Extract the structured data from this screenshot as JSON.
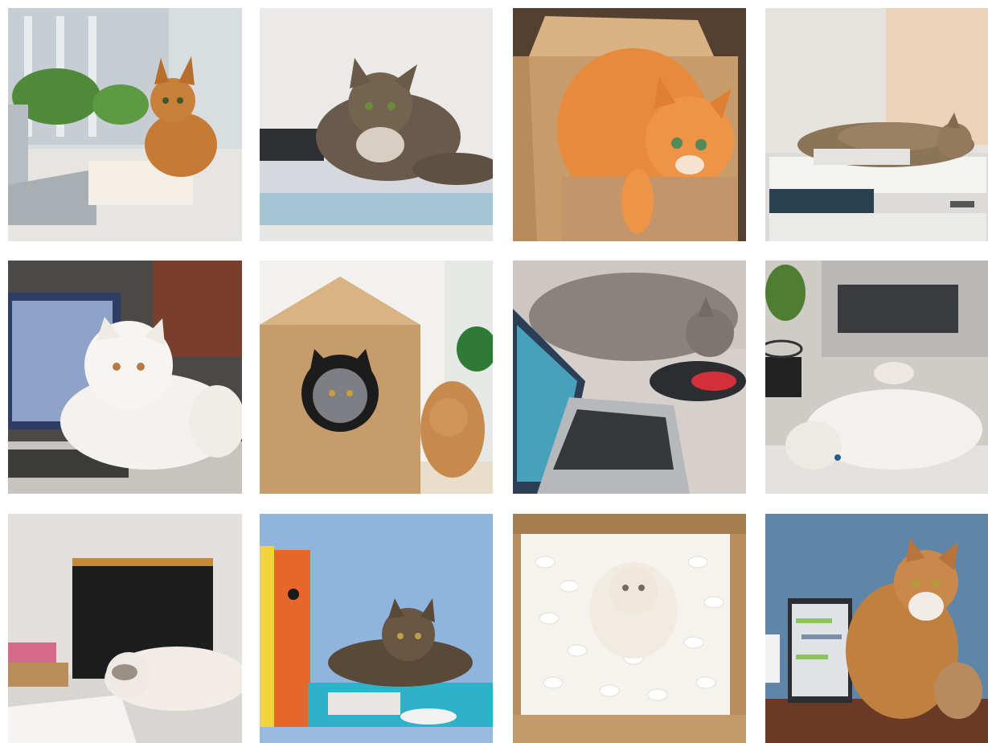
{
  "gallery": {
    "tiles": [
      {
        "subject": "tabby-cat-on-desk-with-laptop-and-book"
      },
      {
        "subject": "tabby-cat-on-papers"
      },
      {
        "subject": "orange-cat-in-cardboard-box"
      },
      {
        "subject": "tabby-cat-sleeping-on-printer"
      },
      {
        "subject": "white-persian-cat-on-laptop"
      },
      {
        "subject": "cat-in-cardboard-cat-house"
      },
      {
        "subject": "gray-cat-sleeping-by-laptop-and-mouse"
      },
      {
        "subject": "white-cat-lying-under-laptop"
      },
      {
        "subject": "fluffy-cat-lying-on-desk-with-notebooks"
      },
      {
        "subject": "tabby-cat-on-blue-binder"
      },
      {
        "subject": "white-cat-in-box-of-packing-peanuts"
      },
      {
        "subject": "calico-cat-sitting-by-laptop"
      }
    ]
  }
}
